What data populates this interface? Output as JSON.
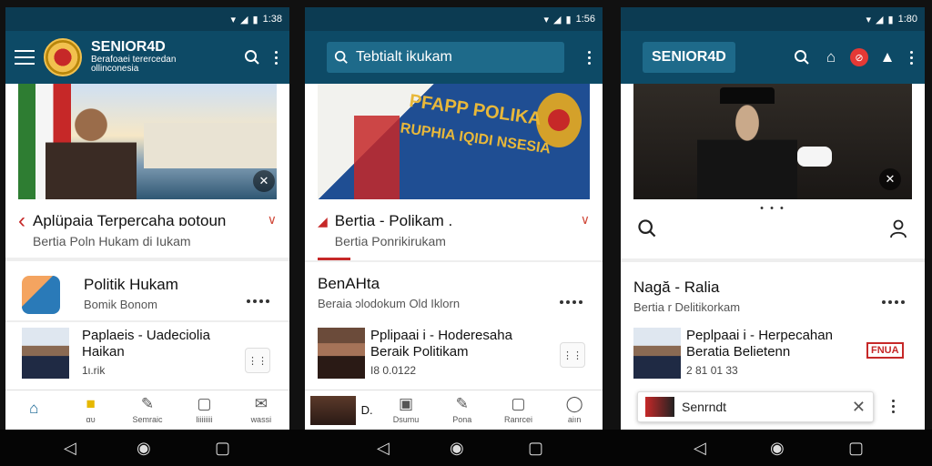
{
  "screens": [
    {
      "status_time": "1:38",
      "brand_title": "SENIOR4D",
      "brand_sub_1": "Berafoaei terercedan",
      "brand_sub_2": "ollinconesia",
      "headline": "Aplüpaia Terpercaha ɒotoun",
      "headline_sub": "Bertia Poln Hukam di Iukam",
      "section_title": "Politik Hukam",
      "section_sub": "Bomik Bonom",
      "card_title_1": "Paplaeis - Uadeciolia",
      "card_title_2": "Haikan",
      "card_meta": "1ι.rik",
      "nav": [
        "",
        "αυ",
        "Semraic",
        "Iiiiiiiii",
        "wassi"
      ]
    },
    {
      "status_time": "1:56",
      "search_text": "Tebtialt ikukam",
      "headline": "Bertia - Polikam .",
      "headline_sub": "Bertia Ponrikirukam",
      "banner_text_1": "PFAPP POLIKA",
      "banner_text_2": "RUPHIA IQIDI NSESIA",
      "section_title": "BenAHta",
      "section_sub": "Beraia ɔlodokum Old Iklorn",
      "card_title_1": "Pplipaai i - Hoderesaha",
      "card_title_2": "Beraik Politikam",
      "card_meta": "I8 0.0122",
      "mini_card_text": "D.",
      "nav": [
        "Dsumu",
        "Pona",
        "Ranrcei",
        "aiın"
      ]
    },
    {
      "status_time": "1:80",
      "brand_box": "SENIOR4D",
      "section_title": "Nagă - Ralia",
      "section_sub": "Bertia r Delitikorkam",
      "card_title_1": "Peplpaai i - Herpecahan",
      "card_title_2": "Beratia Belietenn",
      "card_meta": "2 81 01 33",
      "tag_text": "FNUA",
      "toast_text": "Senrndt"
    }
  ],
  "colors": {
    "appbar": "#0d4a66",
    "statusbar": "#0c3b52",
    "accent_red": "#c62828",
    "nav_active": "#0d5f8f"
  },
  "icons": [
    "menu-icon",
    "search-icon",
    "more-vert-icon",
    "home-icon",
    "bell-icon",
    "user-icon",
    "close-icon",
    "share-icon",
    "back-icon",
    "circle-icon",
    "square-icon"
  ]
}
